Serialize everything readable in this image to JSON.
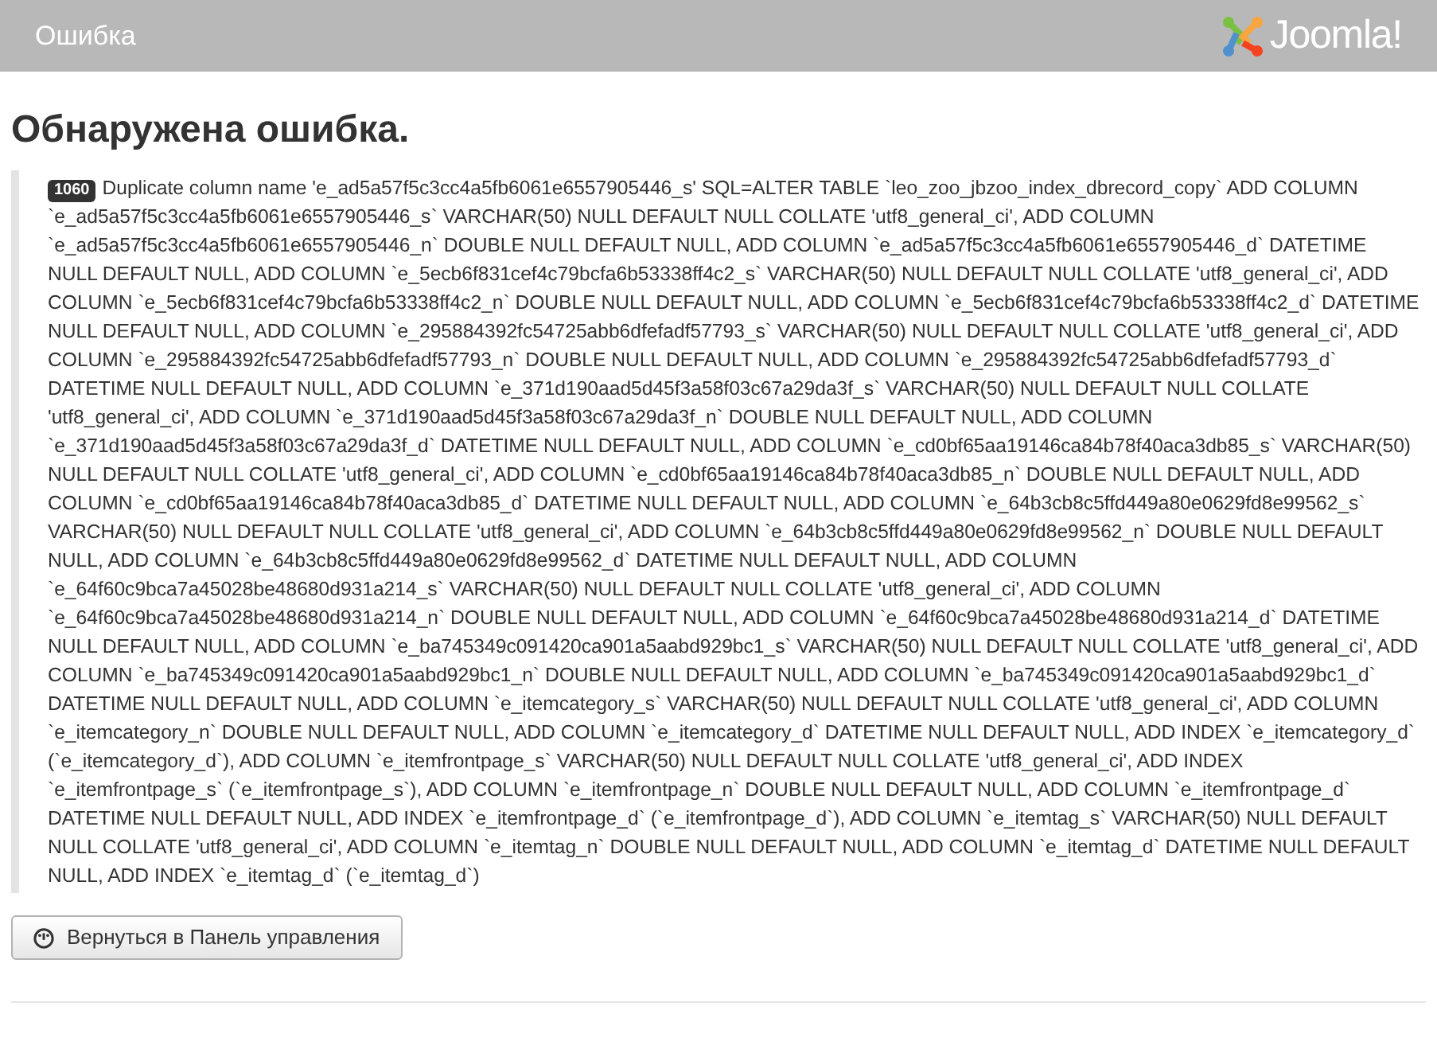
{
  "header": {
    "title": "Ошибка",
    "logo_text": "Joomla!"
  },
  "heading": "Обнаружена ошибка.",
  "error": {
    "code": "1060",
    "message": "Duplicate column name 'e_ad5a57f5c3cc4a5fb6061e6557905446_s' SQL=ALTER TABLE `leo_zoo_jbzoo_index_dbrecord_copy` ADD COLUMN `e_ad5a57f5c3cc4a5fb6061e6557905446_s` VARCHAR(50) NULL DEFAULT NULL COLLATE 'utf8_general_ci', ADD COLUMN `e_ad5a57f5c3cc4a5fb6061e6557905446_n` DOUBLE NULL DEFAULT NULL, ADD COLUMN `e_ad5a57f5c3cc4a5fb6061e6557905446_d` DATETIME NULL DEFAULT NULL, ADD COLUMN `e_5ecb6f831cef4c79bcfa6b53338ff4c2_s` VARCHAR(50) NULL DEFAULT NULL COLLATE 'utf8_general_ci', ADD COLUMN `e_5ecb6f831cef4c79bcfa6b53338ff4c2_n` DOUBLE NULL DEFAULT NULL, ADD COLUMN `e_5ecb6f831cef4c79bcfa6b53338ff4c2_d` DATETIME NULL DEFAULT NULL, ADD COLUMN `e_295884392fc54725abb6dfefadf57793_s` VARCHAR(50) NULL DEFAULT NULL COLLATE 'utf8_general_ci', ADD COLUMN `e_295884392fc54725abb6dfefadf57793_n` DOUBLE NULL DEFAULT NULL, ADD COLUMN `e_295884392fc54725abb6dfefadf57793_d` DATETIME NULL DEFAULT NULL, ADD COLUMN `e_371d190aad5d45f3a58f03c67a29da3f_s` VARCHAR(50) NULL DEFAULT NULL COLLATE 'utf8_general_ci', ADD COLUMN `e_371d190aad5d45f3a58f03c67a29da3f_n` DOUBLE NULL DEFAULT NULL, ADD COLUMN `e_371d190aad5d45f3a58f03c67a29da3f_d` DATETIME NULL DEFAULT NULL, ADD COLUMN `e_cd0bf65aa19146ca84b78f40aca3db85_s` VARCHAR(50) NULL DEFAULT NULL COLLATE 'utf8_general_ci', ADD COLUMN `e_cd0bf65aa19146ca84b78f40aca3db85_n` DOUBLE NULL DEFAULT NULL, ADD COLUMN `e_cd0bf65aa19146ca84b78f40aca3db85_d` DATETIME NULL DEFAULT NULL, ADD COLUMN `e_64b3cb8c5ffd449a80e0629fd8e99562_s` VARCHAR(50) NULL DEFAULT NULL COLLATE 'utf8_general_ci', ADD COLUMN `e_64b3cb8c5ffd449a80e0629fd8e99562_n` DOUBLE NULL DEFAULT NULL, ADD COLUMN `e_64b3cb8c5ffd449a80e0629fd8e99562_d` DATETIME NULL DEFAULT NULL, ADD COLUMN `e_64f60c9bca7a45028be48680d931a214_s` VARCHAR(50) NULL DEFAULT NULL COLLATE 'utf8_general_ci', ADD COLUMN `e_64f60c9bca7a45028be48680d931a214_n` DOUBLE NULL DEFAULT NULL, ADD COLUMN `e_64f60c9bca7a45028be48680d931a214_d` DATETIME NULL DEFAULT NULL, ADD COLUMN `e_ba745349c091420ca901a5aabd929bc1_s` VARCHAR(50) NULL DEFAULT NULL COLLATE 'utf8_general_ci', ADD COLUMN `e_ba745349c091420ca901a5aabd929bc1_n` DOUBLE NULL DEFAULT NULL, ADD COLUMN `e_ba745349c091420ca901a5aabd929bc1_d` DATETIME NULL DEFAULT NULL, ADD COLUMN `e_itemcategory_s` VARCHAR(50) NULL DEFAULT NULL COLLATE 'utf8_general_ci', ADD COLUMN `e_itemcategory_n` DOUBLE NULL DEFAULT NULL, ADD COLUMN `e_itemcategory_d` DATETIME NULL DEFAULT NULL, ADD INDEX `e_itemcategory_d` (`e_itemcategory_d`), ADD COLUMN `e_itemfrontpage_s` VARCHAR(50) NULL DEFAULT NULL COLLATE 'utf8_general_ci', ADD INDEX `e_itemfrontpage_s` (`e_itemfrontpage_s`), ADD COLUMN `e_itemfrontpage_n` DOUBLE NULL DEFAULT NULL, ADD COLUMN `e_itemfrontpage_d` DATETIME NULL DEFAULT NULL, ADD INDEX `e_itemfrontpage_d` (`e_itemfrontpage_d`), ADD COLUMN `e_itemtag_s` VARCHAR(50) NULL DEFAULT NULL COLLATE 'utf8_general_ci', ADD COLUMN `e_itemtag_n` DOUBLE NULL DEFAULT NULL, ADD COLUMN `e_itemtag_d` DATETIME NULL DEFAULT NULL, ADD INDEX `e_itemtag_d` (`e_itemtag_d`)"
  },
  "back_button": {
    "label": "Вернуться в Панель управления"
  }
}
